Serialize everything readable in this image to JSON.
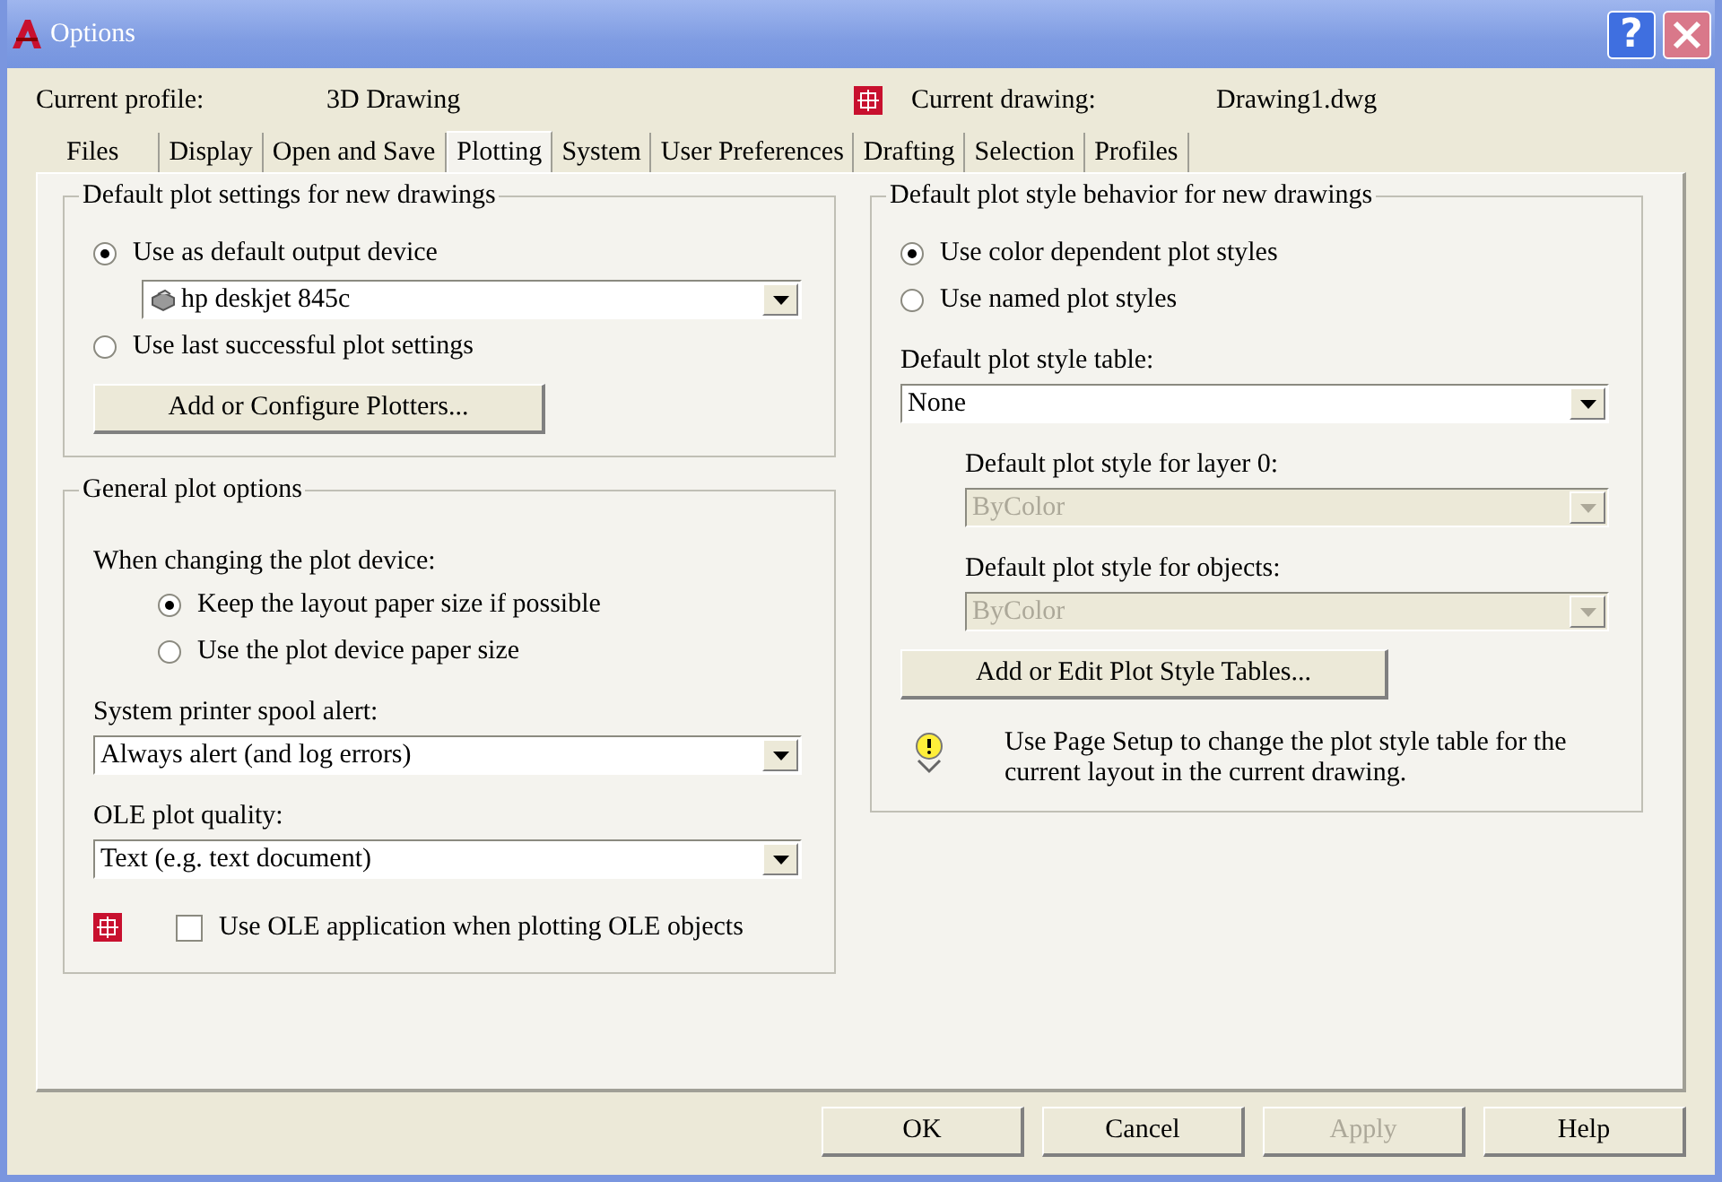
{
  "window": {
    "title": "Options"
  },
  "title_buttons": [
    {
      "kind": "help",
      "label": "?"
    },
    {
      "kind": "close"
    }
  ],
  "profile": {
    "label": "Current profile:",
    "value": "3D Drawing"
  },
  "drawing": {
    "label": "Current drawing:",
    "value": "Drawing1.dwg"
  },
  "tabs": [
    {
      "label": "Files",
      "selected": false
    },
    {
      "label": "Display",
      "selected": false
    },
    {
      "label": "Open and Save",
      "selected": false
    },
    {
      "label": "Plotting",
      "selected": true
    },
    {
      "label": "System",
      "selected": false
    },
    {
      "label": "User Preferences",
      "selected": false
    },
    {
      "label": "Drafting",
      "selected": false
    },
    {
      "label": "Selection",
      "selected": false
    },
    {
      "label": "Profiles",
      "selected": false
    }
  ],
  "left_groups": [
    {
      "title": "Default plot settings for new drawings",
      "items": [
        {
          "kind": "radio",
          "label": "Use as default output device",
          "selected": true
        },
        {
          "kind": "device_dropdown",
          "value": "hp deskjet 845c",
          "disabled": false
        },
        {
          "kind": "radio",
          "label": "Use last successful plot settings",
          "selected": false
        },
        {
          "kind": "button",
          "label": "Add or Configure Plotters..."
        }
      ]
    },
    {
      "title": "General plot options",
      "items": [
        {
          "kind": "label",
          "text": "When changing the plot device:"
        },
        {
          "kind": "indent",
          "children": [
            {
              "kind": "radio",
              "label": "Keep the layout paper size if possible",
              "selected": true
            },
            {
              "kind": "radio",
              "label": "Use the plot device paper size",
              "selected": false
            }
          ]
        },
        {
          "kind": "label",
          "text": "System printer spool alert:"
        },
        {
          "kind": "dropdown",
          "value": "Always alert (and log errors)",
          "disabled": false
        },
        {
          "kind": "label",
          "text": "OLE plot quality:"
        },
        {
          "kind": "dropdown",
          "value": "Text (e.g. text document)",
          "disabled": false
        },
        {
          "kind": "checkbox",
          "label": "Use OLE application when plotting OLE objects",
          "checked": false,
          "saved_in_drawing": true
        }
      ]
    }
  ],
  "right_groups": [
    {
      "title": "Default plot style behavior for new drawings",
      "items": [
        {
          "kind": "radio",
          "label": "Use color dependent plot styles",
          "selected": true
        },
        {
          "kind": "radio",
          "label": "Use named plot styles",
          "selected": false
        },
        {
          "kind": "label",
          "text": "Default plot style table:"
        },
        {
          "kind": "dropdown",
          "value": "None",
          "disabled": false
        },
        {
          "kind": "indent",
          "children": [
            {
              "kind": "label",
              "text": "Default plot style for layer 0:"
            },
            {
              "kind": "dropdown",
              "value": "ByColor",
              "disabled": true
            },
            {
              "kind": "label",
              "text": "Default plot style for objects:"
            },
            {
              "kind": "dropdown",
              "value": "ByColor",
              "disabled": true
            }
          ]
        },
        {
          "kind": "button",
          "label": "Add or Edit Plot Style Tables..."
        },
        {
          "kind": "note",
          "text": "Use Page Setup to change the plot style table for the current layout in the current drawing."
        }
      ]
    }
  ],
  "buttons": [
    {
      "label": "OK",
      "disabled": false
    },
    {
      "label": "Cancel",
      "disabled": false
    },
    {
      "label": "Apply",
      "disabled": true
    },
    {
      "label": "Help",
      "disabled": false
    }
  ]
}
